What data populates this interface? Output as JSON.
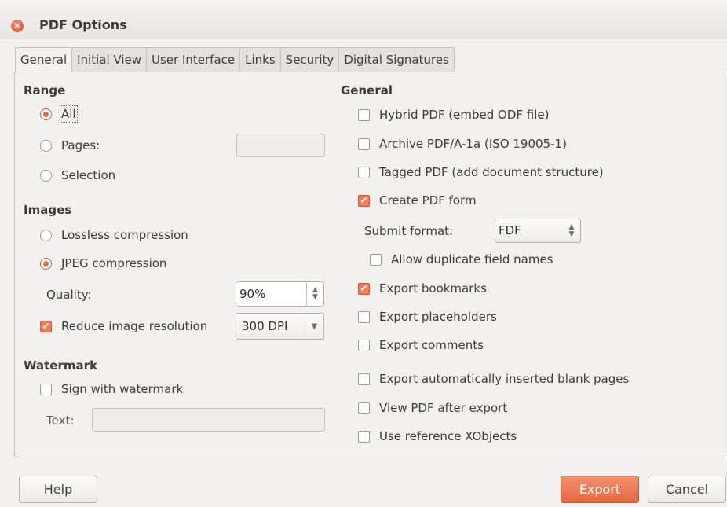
{
  "window": {
    "title": "PDF Options"
  },
  "tabs": [
    "General",
    "Initial View",
    "User Interface",
    "Links",
    "Security",
    "Digital Signatures"
  ],
  "range": {
    "title": "Range",
    "all": "All",
    "pages": "Pages:",
    "pages_value": "",
    "selection": "Selection",
    "selected": "All"
  },
  "images": {
    "title": "Images",
    "lossless": "Lossless compression",
    "jpeg": "JPEG compression",
    "selected": "JPEG compression",
    "quality_label": "Quality:",
    "quality_value": "90%",
    "reduce_label": "Reduce image resolution",
    "reduce_checked": true,
    "resolution_value": "300 DPI"
  },
  "watermark": {
    "title": "Watermark",
    "sign_label": "Sign with watermark",
    "sign_checked": false,
    "text_label": "Text:",
    "text_value": ""
  },
  "general": {
    "title": "General",
    "hybrid": "Hybrid PDF (embed ODF file)",
    "archive": "Archive PDF/A-1a (ISO 19005-1)",
    "tagged": "Tagged PDF (add document structure)",
    "create_form": "Create PDF form",
    "submit_label": "Submit format:",
    "submit_value": "FDF",
    "allow_dup": "Allow duplicate field names",
    "bookmarks": "Export bookmarks",
    "placeholders": "Export placeholders",
    "comments": "Export comments",
    "blank_pages": "Export automatically inserted blank pages",
    "view_after": "View PDF after export",
    "xobjects": "Use reference XObjects"
  },
  "buttons": {
    "help": "Help",
    "export": "Export",
    "cancel": "Cancel"
  }
}
